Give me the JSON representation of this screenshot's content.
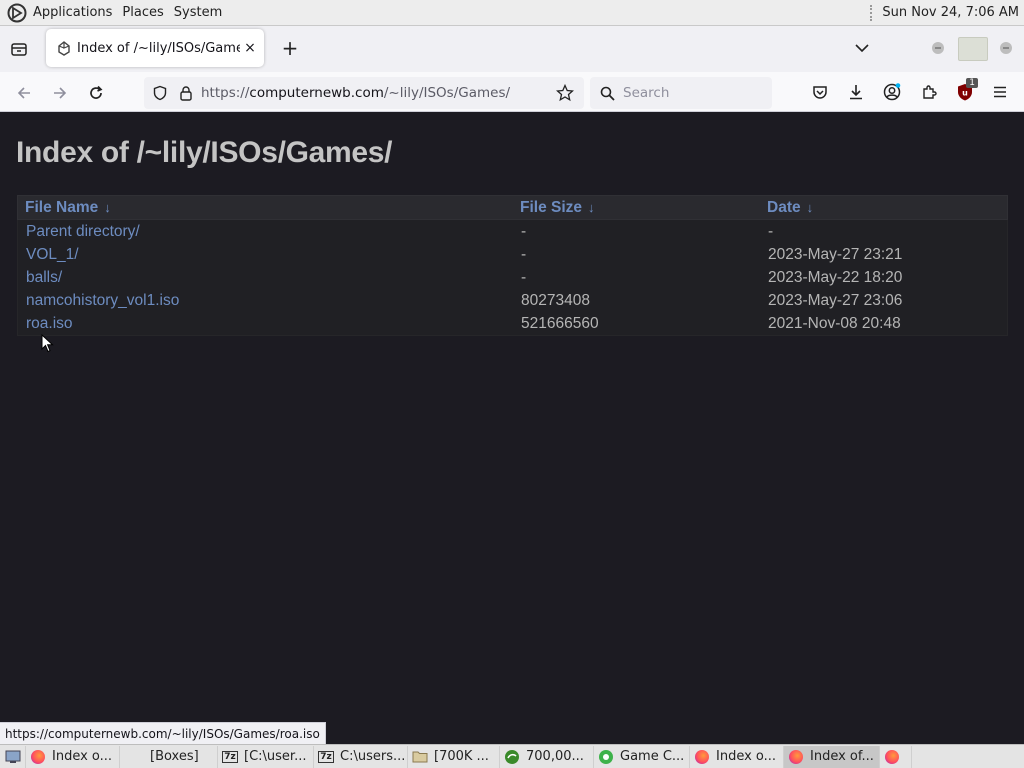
{
  "top_panel": {
    "menus": [
      "Applications",
      "Places",
      "System"
    ],
    "clock": "Sun Nov 24,  7:06 AM"
  },
  "browser": {
    "tab": {
      "title": "Index of /~lily/ISOs/Games/",
      "close": "×"
    },
    "new_tab": "+",
    "url": {
      "prefix": "https://",
      "host": "computernewb.com",
      "path": "/~lily/ISOs/Games/"
    },
    "search": {
      "placeholder": "Search"
    },
    "ublock_badge": "1"
  },
  "page": {
    "title": "Index of /~lily/ISOs/Games/",
    "columns": [
      {
        "label": "File Name",
        "arrow": "↓"
      },
      {
        "label": "File Size",
        "arrow": "↓"
      },
      {
        "label": "Date",
        "arrow": "↓"
      }
    ],
    "rows": [
      {
        "name": "Parent directory/",
        "size": "-",
        "date": "-"
      },
      {
        "name": "VOL_1/",
        "size": "-",
        "date": "2023-May-27 23:21"
      },
      {
        "name": "balls/",
        "size": "-",
        "date": "2023-May-22 18:20"
      },
      {
        "name": "namcohistory_vol1.iso",
        "size": "80273408",
        "date": "2023-May-27 23:06"
      },
      {
        "name": "roa.iso",
        "size": "521666560",
        "date": "2021-Nov-08 20:48"
      }
    ]
  },
  "status_bar": {
    "text": "https://computernewb.com/~lily/ISOs/Games/roa.iso"
  },
  "taskbar": {
    "items": [
      {
        "label": "Index o...",
        "icon": "firefox-icon"
      },
      {
        "label": "[Boxes]",
        "icon": "none"
      },
      {
        "label": "[C:\\user...",
        "icon": "7zip-icon"
      },
      {
        "label": "C:\\users...",
        "icon": "7zip-icon"
      },
      {
        "label": "[700K ...",
        "icon": "folder-icon"
      },
      {
        "label": "700,00...",
        "icon": "torrent-icon"
      },
      {
        "label": "Game C...",
        "icon": "game-icon"
      },
      {
        "label": "Index o...",
        "icon": "firefox-icon"
      },
      {
        "label": "Index of...",
        "icon": "firefox-icon"
      },
      {
        "label": "",
        "icon": "firefox-icon"
      }
    ]
  },
  "colors": {
    "page_bg": "#1c1b22",
    "link": "#6d8cc0",
    "text": "#b5b5b5"
  }
}
